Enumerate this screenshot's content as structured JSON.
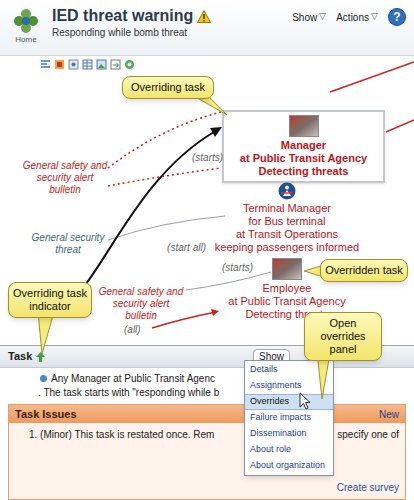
{
  "header": {
    "logo_label": "Home",
    "title": "IED threat warning",
    "subtitle": "Responding while bomb threat",
    "menus": [
      {
        "label": "Show",
        "arrow": "▽"
      },
      {
        "label": "Actions",
        "arrow": "▽"
      }
    ],
    "help": "?"
  },
  "diagram": {
    "nodes": [
      {
        "lines": [
          "Manager",
          "at Public Transit Agency",
          "Detecting threats"
        ],
        "selected": true,
        "kind": "photo"
      },
      {
        "lines": [
          "Terminal Manager",
          "for Bus terminal",
          "at Transit Operations",
          "keeping passengers informed"
        ],
        "selected": false,
        "kind": "badge"
      },
      {
        "lines": [
          "Employee",
          "at Public Transit Agency",
          "Detecting threats"
        ],
        "selected": false,
        "kind": "photo"
      }
    ],
    "edge_labels": [
      {
        "lines": [
          "(starts)"
        ],
        "color": "#666666"
      },
      {
        "lines": [
          "General safety and",
          "security alert",
          "bulletin"
        ],
        "color": "#cc2222"
      },
      {
        "lines": [
          "General security",
          "threat"
        ],
        "color": "#3d6b6b"
      },
      {
        "lines": [
          "(start all)"
        ],
        "color": "#666666"
      },
      {
        "lines": [
          "(starts)"
        ],
        "color": "#666666"
      },
      {
        "lines": [
          "General safety and",
          "security alert",
          "bulletin"
        ],
        "color": "#cc2222"
      },
      {
        "lines": [
          "(all)"
        ],
        "color": "#666666"
      }
    ]
  },
  "callouts": [
    "Overriding task",
    "Overridden task",
    "Overriding task indicator",
    "Open overrides panel"
  ],
  "task_panel": {
    "title": "Task",
    "show_button": "Show",
    "lines": [
      "Any Manager at Public Transit Agenc",
      ". The task starts with \"responding while b"
    ],
    "issues": {
      "title": "Task Issues",
      "new": "New",
      "items": [
        {
          "text": "1. (Minor) This task is restated once. Rem",
          "tail": "specify one of"
        }
      ],
      "link": "Create survey"
    }
  },
  "menu": [
    {
      "label": "Details",
      "selected": false
    },
    {
      "label": "Assignments",
      "selected": false
    },
    {
      "label": "Overrides",
      "selected": true
    },
    {
      "label": "Failure impacts",
      "selected": false
    },
    {
      "label": "Dissemination",
      "selected": false
    },
    {
      "label": "About role",
      "selected": false
    },
    {
      "label": "About organization",
      "selected": false
    }
  ]
}
